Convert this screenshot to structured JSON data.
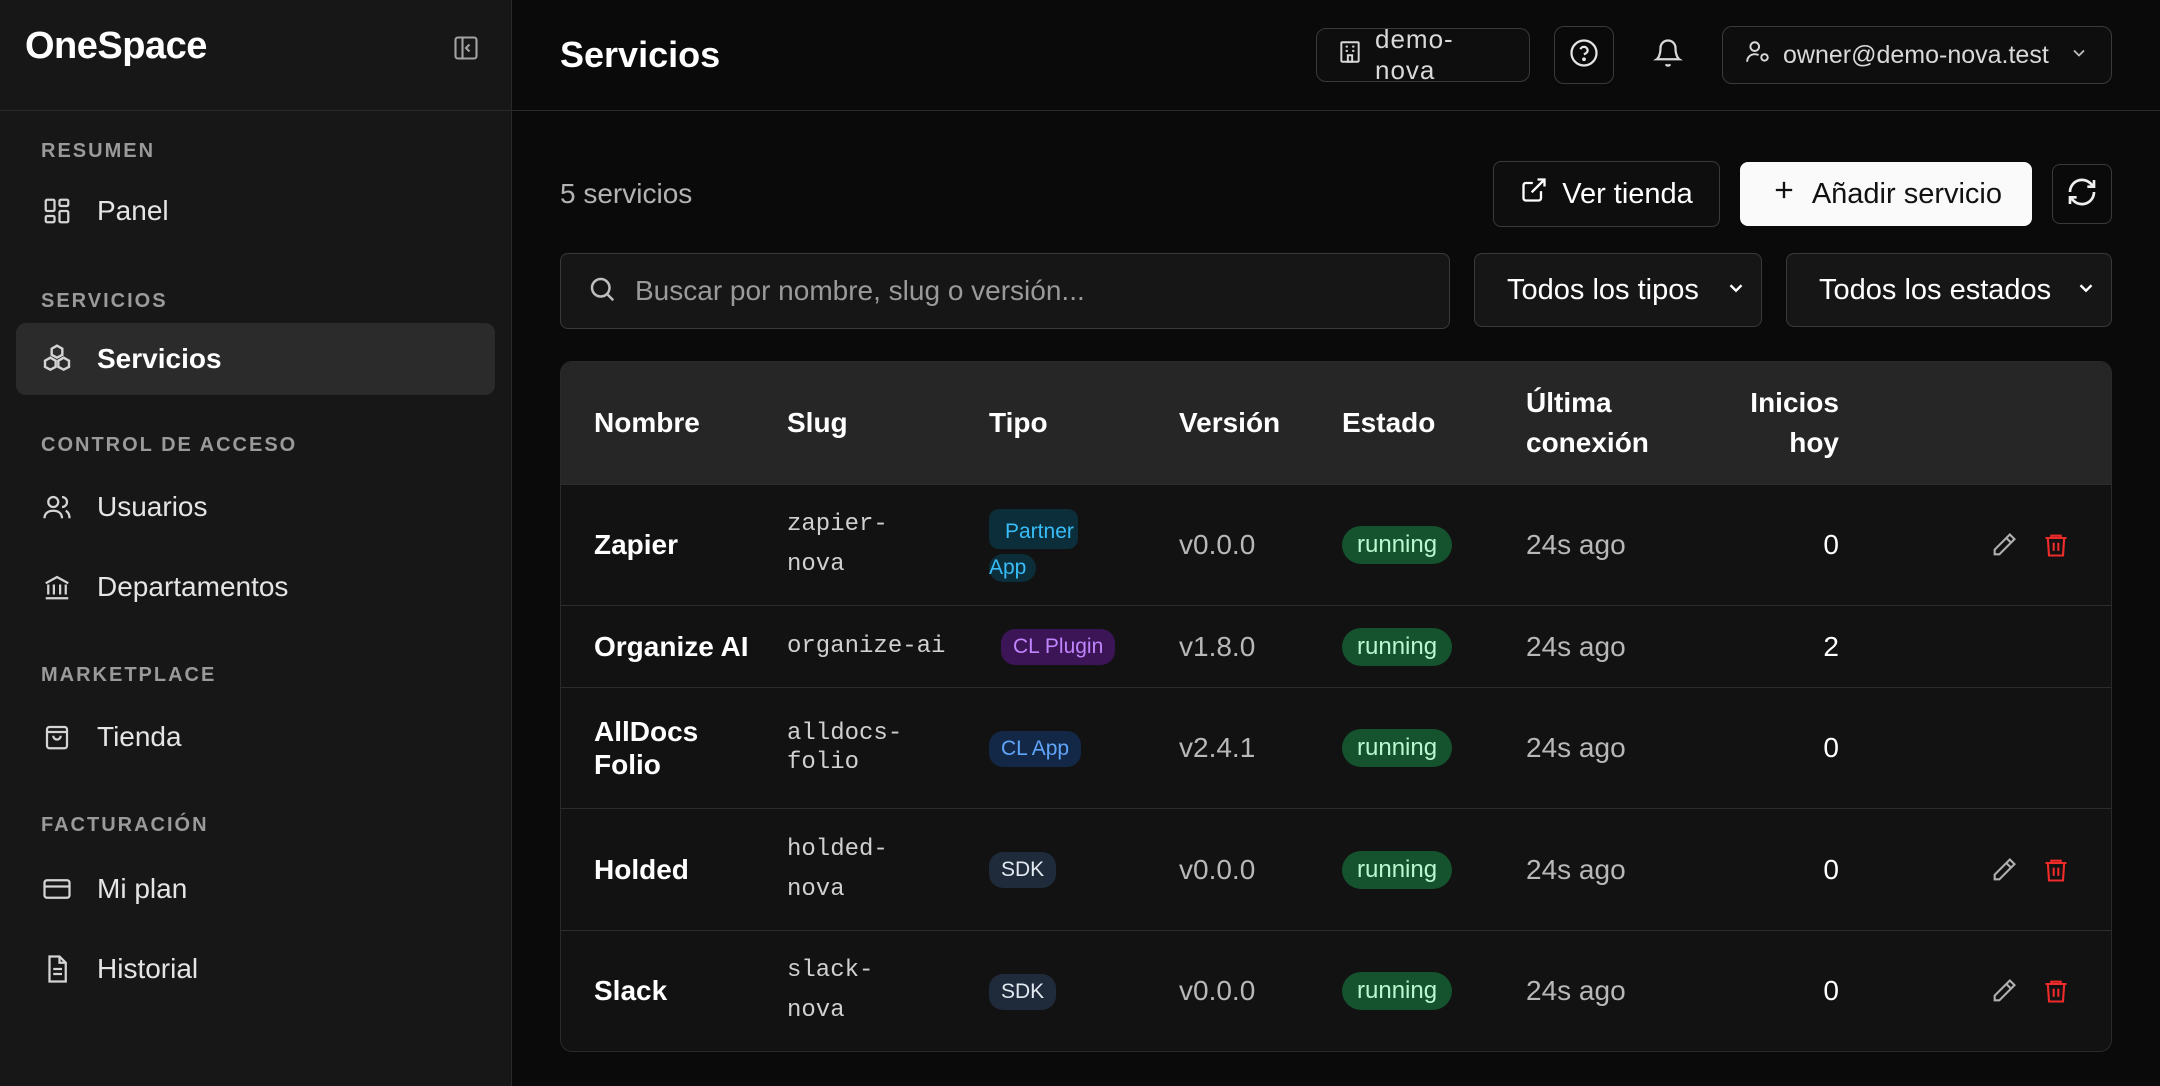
{
  "app": {
    "brand": "OneSpace"
  },
  "sidebar": {
    "sections": [
      {
        "label": "RESUMEN",
        "items": [
          {
            "label": "Panel",
            "icon": "dashboard-icon"
          }
        ]
      },
      {
        "label": "SERVICIOS",
        "items": [
          {
            "label": "Servicios",
            "icon": "services-icon",
            "active": true
          }
        ]
      },
      {
        "label": "CONTROL DE ACCESO",
        "items": [
          {
            "label": "Usuarios",
            "icon": "users-icon"
          },
          {
            "label": "Departamentos",
            "icon": "building-columns-icon"
          }
        ]
      },
      {
        "label": "MARKETPLACE",
        "items": [
          {
            "label": "Tienda",
            "icon": "shopping-bag-icon"
          }
        ]
      },
      {
        "label": "FACTURACIÓN",
        "items": [
          {
            "label": "Mi plan",
            "icon": "credit-card-icon"
          },
          {
            "label": "Historial",
            "icon": "document-icon"
          }
        ]
      }
    ]
  },
  "header": {
    "title": "Servicios",
    "workspace": "demo-nova",
    "user": "owner@demo-nova.test"
  },
  "toolbar": {
    "count": "5 servicios",
    "store_label": "Ver tienda",
    "add_label": "Añadir servicio"
  },
  "filters": {
    "search_placeholder": "Buscar por nombre, slug o versión...",
    "type_selected": "Todos los tipos",
    "state_selected": "Todos los estados"
  },
  "table": {
    "columns": {
      "name": "Nombre",
      "slug": "Slug",
      "type": "Tipo",
      "version": "Versión",
      "state": "Estado",
      "last_conn_1": "Última",
      "last_conn_2": "conexión",
      "starts_1": "Inicios",
      "starts_2": "hoy"
    },
    "rows": [
      {
        "name": "Zapier",
        "slug_1": "zapier-",
        "slug_2": "nova",
        "type_1": "Partner",
        "type_2": "App",
        "version": "v0.0.0",
        "state": "running",
        "last": "24s ago",
        "starts": "0"
      },
      {
        "name": "Organize AI",
        "slug_1": "organize-ai",
        "type_1": "CL Plugin",
        "version": "v1.8.0",
        "state": "running",
        "last": "24s ago",
        "starts": "2"
      },
      {
        "name_1": "AllDocs",
        "name_2": "Folio",
        "slug_1": "alldocs-",
        "slug_2": "folio",
        "type_1": "CL App",
        "version": "v2.4.1",
        "state": "running",
        "last": "24s ago",
        "starts": "0"
      },
      {
        "name": "Holded",
        "slug_1": "holded-",
        "slug_2": "nova",
        "type_1": "SDK",
        "version": "v0.0.0",
        "state": "running",
        "last": "24s ago",
        "starts": "0"
      },
      {
        "name": "Slack",
        "slug_1": "slack-",
        "slug_2": "nova",
        "type_1": "SDK",
        "version": "v0.0.0",
        "state": "running",
        "last": "24s ago",
        "starts": "0"
      }
    ]
  },
  "colors": {
    "background": "#0a0a0a",
    "sidebar": "#171717",
    "running": "#14532d",
    "delete": "#ef2b2b"
  }
}
